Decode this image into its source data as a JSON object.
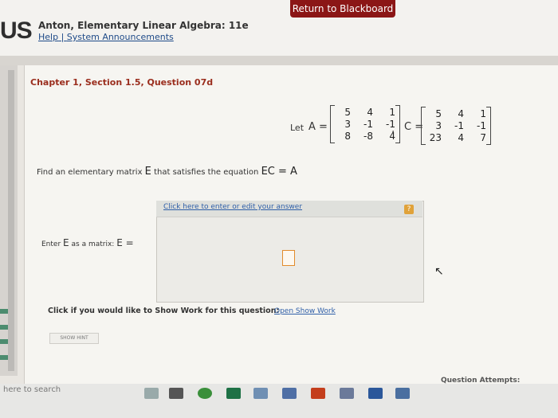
{
  "header": {
    "return_button": "Return to Blackboard",
    "logo": "US",
    "course_title": "Anton, Elementary Linear Algebra: 11e",
    "help_link": "Help",
    "separator": "|",
    "announcements_link": "System Announcements"
  },
  "question": {
    "title": "Chapter 1, Section 1.5, Question 07d",
    "let_label": "Let",
    "matrix_a_label": "A =",
    "matrix_a": [
      [
        "5",
        "4",
        "1"
      ],
      [
        "3",
        "-1",
        "-1"
      ],
      [
        "8",
        "-8",
        "4"
      ]
    ],
    "comma": ",",
    "matrix_c_label": "C =",
    "matrix_c": [
      [
        "5",
        "4",
        "1"
      ],
      [
        "3",
        "-1",
        "-1"
      ],
      [
        "23",
        "4",
        "7"
      ]
    ],
    "find_prefix": "Find an elementary matrix",
    "find_var": "E",
    "find_middle": "that satisfies the equation",
    "find_equation": "EC = A"
  },
  "answer": {
    "link_text": "Click here to enter or edit your answer",
    "help_icon": "?",
    "enter_prefix": "Enter",
    "enter_var": "E",
    "enter_middle": "as a matrix:",
    "enter_eq": "E ="
  },
  "footer": {
    "show_work_text": "Click if you would like to Show Work for this question:",
    "show_work_link": "Open Show Work",
    "hint_button": "SHOW HINT",
    "attempts": "Question Attempts: Unlimited"
  },
  "taskbar": {
    "search_placeholder": "here to search"
  },
  "colors": {
    "accent_red": "#8b1616",
    "link_blue": "#2f5fa8",
    "title_red": "#9a2d1d"
  }
}
